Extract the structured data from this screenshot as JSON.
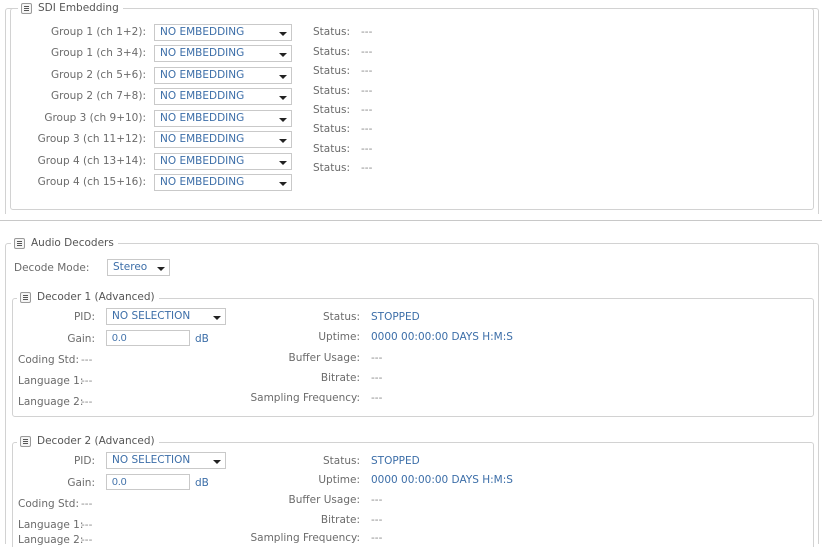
{
  "sdi": {
    "title": "SDI Embedding",
    "groups": [
      {
        "label": "Group 1 (ch 1+2):",
        "value": "NO EMBEDDING"
      },
      {
        "label": "Group 1 (ch 3+4):",
        "value": "NO EMBEDDING"
      },
      {
        "label": "Group 2 (ch 5+6):",
        "value": "NO EMBEDDING"
      },
      {
        "label": "Group 2 (ch 7+8):",
        "value": "NO EMBEDDING"
      },
      {
        "label": "Group 3 (ch 9+10):",
        "value": "NO EMBEDDING"
      },
      {
        "label": "Group 3 (ch 11+12):",
        "value": "NO EMBEDDING"
      },
      {
        "label": "Group 4 (ch 13+14):",
        "value": "NO EMBEDDING"
      },
      {
        "label": "Group 4 (ch 15+16):",
        "value": "NO EMBEDDING"
      }
    ],
    "status_label": "Status:",
    "status_value": "---"
  },
  "audio": {
    "title": "Audio Decoders",
    "decode_mode_label": "Decode Mode:",
    "decode_mode_value": "Stereo",
    "decoders": [
      {
        "title": "Decoder 1 (Advanced)",
        "pid_label": "PID:",
        "pid_value": "NO SELECTION",
        "gain_label": "Gain:",
        "gain_value": "0.0",
        "gain_unit": "dB",
        "coding_label": "Coding Std:",
        "coding_value": "---",
        "lang1_label": "Language 1:",
        "lang1_value": "---",
        "lang2_label": "Language 2:",
        "lang2_value": "---",
        "status_label": "Status:",
        "status_value": "STOPPED",
        "uptime_label": "Uptime:",
        "uptime_value": "0000 00:00:00 DAYS H:M:S",
        "buffer_label": "Buffer Usage:",
        "buffer_value": "---",
        "bitrate_label": "Bitrate:",
        "bitrate_value": "---",
        "sampling_label": "Sampling Frequency:",
        "sampling_value": "---"
      },
      {
        "title": "Decoder 2 (Advanced)",
        "pid_label": "PID:",
        "pid_value": "NO SELECTION",
        "gain_label": "Gain:",
        "gain_value": "0.0",
        "gain_unit": "dB",
        "coding_label": "Coding Std:",
        "coding_value": "---",
        "lang1_label": "Language 1:",
        "lang1_value": "---",
        "lang2_label": "Language 2:",
        "lang2_value": "---",
        "status_label": "Status:",
        "status_value": "STOPPED",
        "uptime_label": "Uptime:",
        "uptime_value": "0000 00:00:00 DAYS H:M:S",
        "buffer_label": "Buffer Usage:",
        "buffer_value": "---",
        "bitrate_label": "Bitrate:",
        "bitrate_value": "---",
        "sampling_label": "Sampling Frequency:",
        "sampling_value": "---"
      }
    ]
  }
}
